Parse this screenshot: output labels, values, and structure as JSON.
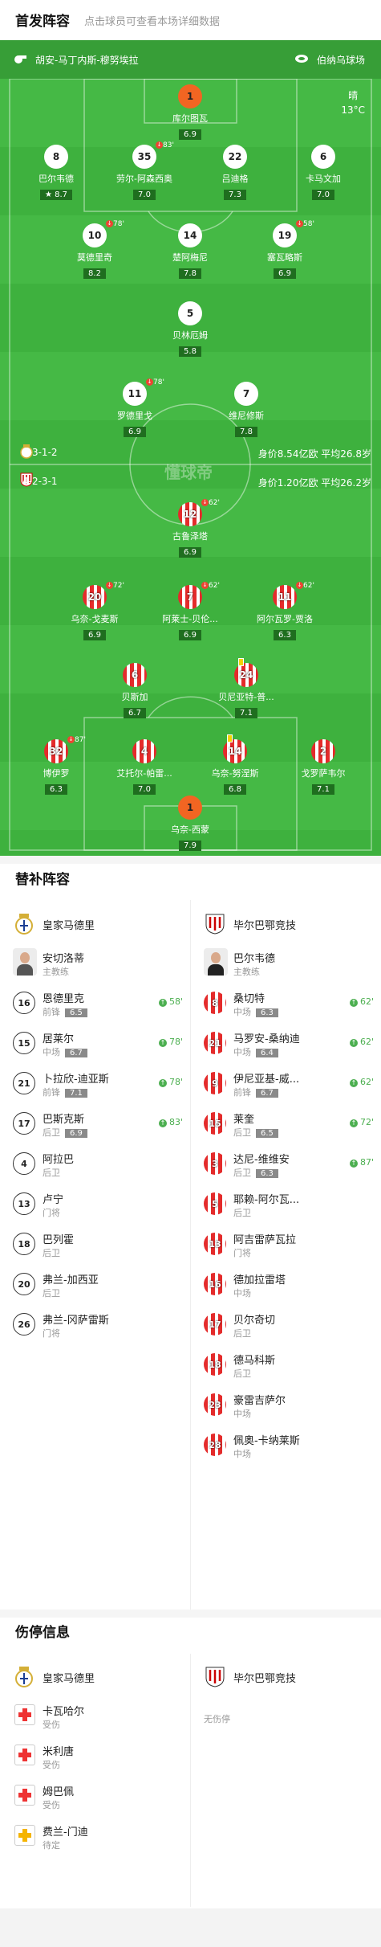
{
  "header": {
    "title": "首发阵容",
    "subtitle": "点击球员可查看本场详细数据"
  },
  "pitch": {
    "referee_left": "胡安-马丁内斯-穆努埃拉",
    "referee_right": "伯纳乌球场",
    "weather": "晴",
    "temperature": "13°C",
    "watermark": "懂球帝",
    "home_formation": "4-3-1-2",
    "home_value": "身价8.54亿欧  平均26.8岁",
    "away_formation": "4-2-3-1",
    "away_value": "身价1.20亿欧  平均26.2岁",
    "home_players": [
      {
        "num": "1",
        "name": "库尔图瓦",
        "rating": "6.9",
        "gk": true
      },
      {
        "num": "8",
        "name": "巴尔韦德",
        "rating": "8.7",
        "star": true
      },
      {
        "num": "35",
        "name": "劳尔-阿森西奥",
        "rating": "7.0",
        "sub": "83'"
      },
      {
        "num": "22",
        "name": "吕迪格",
        "rating": "7.3"
      },
      {
        "num": "6",
        "name": "卡马文加",
        "rating": "7.0"
      },
      {
        "num": "10",
        "name": "莫德里奇",
        "rating": "8.2",
        "sub": "78'"
      },
      {
        "num": "14",
        "name": "楚阿梅尼",
        "rating": "7.8"
      },
      {
        "num": "19",
        "name": "塞瓦略斯",
        "rating": "6.9",
        "sub": "58'"
      },
      {
        "num": "5",
        "name": "贝林厄姆",
        "rating": "5.8"
      },
      {
        "num": "11",
        "name": "罗德里戈",
        "rating": "6.9",
        "sub": "78'"
      },
      {
        "num": "7",
        "name": "维尼修斯",
        "rating": "7.8"
      }
    ],
    "away_players": [
      {
        "num": "12",
        "name": "古鲁泽塔",
        "rating": "6.9",
        "sub": "62'"
      },
      {
        "num": "20",
        "name": "乌奈-戈麦斯",
        "rating": "6.9",
        "sub": "72'"
      },
      {
        "num": "7",
        "name": "阿莱士-贝伦...",
        "rating": "6.9",
        "sub": "62'"
      },
      {
        "num": "11",
        "name": "阿尔瓦罗-贾洛",
        "rating": "6.3",
        "sub": "62'"
      },
      {
        "num": "6",
        "name": "贝斯加",
        "rating": "6.7"
      },
      {
        "num": "24",
        "name": "贝尼亚特-普...",
        "rating": "7.1",
        "yellow": true
      },
      {
        "num": "32",
        "name": "博伊罗",
        "rating": "6.3",
        "sub": "87'"
      },
      {
        "num": "4",
        "name": "艾托尔-帕雷...",
        "rating": "7.0"
      },
      {
        "num": "14",
        "name": "乌奈-努涅斯",
        "rating": "6.8",
        "yellow": true
      },
      {
        "num": "2",
        "name": "戈罗萨韦尔",
        "rating": "7.1"
      },
      {
        "num": "1",
        "name": "乌奈-西蒙",
        "rating": "7.9",
        "gk": true
      }
    ]
  },
  "subs": {
    "title": "替补阵容",
    "home_club": "皇家马德里",
    "away_club": "毕尔巴鄂竞技",
    "home_coach": {
      "name": "安切洛蒂",
      "role": "主教练"
    },
    "away_coach": {
      "name": "巴尔韦德",
      "role": "主教练"
    },
    "home": [
      {
        "num": "16",
        "name": "恩德里克",
        "pos": "前锋",
        "rating": "6.5",
        "min": "58'"
      },
      {
        "num": "15",
        "name": "居莱尔",
        "pos": "中场",
        "rating": "6.7",
        "min": "78'"
      },
      {
        "num": "21",
        "name": "卜拉欣-迪亚斯",
        "pos": "前锋",
        "rating": "7.1",
        "min": "78'"
      },
      {
        "num": "17",
        "name": "巴斯克斯",
        "pos": "后卫",
        "rating": "6.9",
        "min": "83'"
      },
      {
        "num": "4",
        "name": "阿拉巴",
        "pos": "后卫"
      },
      {
        "num": "13",
        "name": "卢宁",
        "pos": "门将"
      },
      {
        "num": "18",
        "name": "巴列霍",
        "pos": "后卫"
      },
      {
        "num": "20",
        "name": "弗兰-加西亚",
        "pos": "后卫"
      },
      {
        "num": "26",
        "name": "弗兰-冈萨雷斯",
        "pos": "门将"
      }
    ],
    "away": [
      {
        "num": "8",
        "name": "桑切特",
        "pos": "中场",
        "rating": "6.3",
        "min": "62'"
      },
      {
        "num": "21",
        "name": "马罗安-桑纳迪",
        "pos": "中场",
        "rating": "6.4",
        "min": "62'"
      },
      {
        "num": "9",
        "name": "伊尼亚基-威...",
        "pos": "前锋",
        "rating": "6.7",
        "min": "62'"
      },
      {
        "num": "15",
        "name": "莱奎",
        "pos": "后卫",
        "rating": "6.5",
        "min": "72'"
      },
      {
        "num": "3",
        "name": "达尼-维维安",
        "pos": "后卫",
        "rating": "6.3",
        "min": "87'"
      },
      {
        "num": "5",
        "name": "耶赖-阿尔瓦...",
        "pos": "后卫"
      },
      {
        "num": "13",
        "name": "阿吉雷萨瓦拉",
        "pos": "门将"
      },
      {
        "num": "16",
        "name": "德加拉雷塔",
        "pos": "中场"
      },
      {
        "num": "17",
        "name": "贝尔奇切",
        "pos": "后卫"
      },
      {
        "num": "18",
        "name": "德马科斯",
        "pos": "后卫"
      },
      {
        "num": "23",
        "name": "豪雷吉萨尔",
        "pos": "中场"
      },
      {
        "num": "28",
        "name": "佩奥-卡纳莱斯",
        "pos": "中场"
      }
    ]
  },
  "injuries": {
    "title": "伤停信息",
    "home_club": "皇家马德里",
    "away_club": "毕尔巴鄂竞技",
    "away_none": "无伤停",
    "home": [
      {
        "name": "卡瓦哈尔",
        "status": "受伤"
      },
      {
        "name": "米利唐",
        "status": "受伤"
      },
      {
        "name": "姆巴佩",
        "status": "受伤"
      },
      {
        "name": "费兰-门迪",
        "status": "待定"
      }
    ]
  },
  "colors": {
    "pitch": "#3eb13e",
    "rating_badge": "#1f6e1f",
    "gk_shirt": "#f26522",
    "away_stripe": "#e42b2b",
    "sub_green": "#4caf50"
  }
}
